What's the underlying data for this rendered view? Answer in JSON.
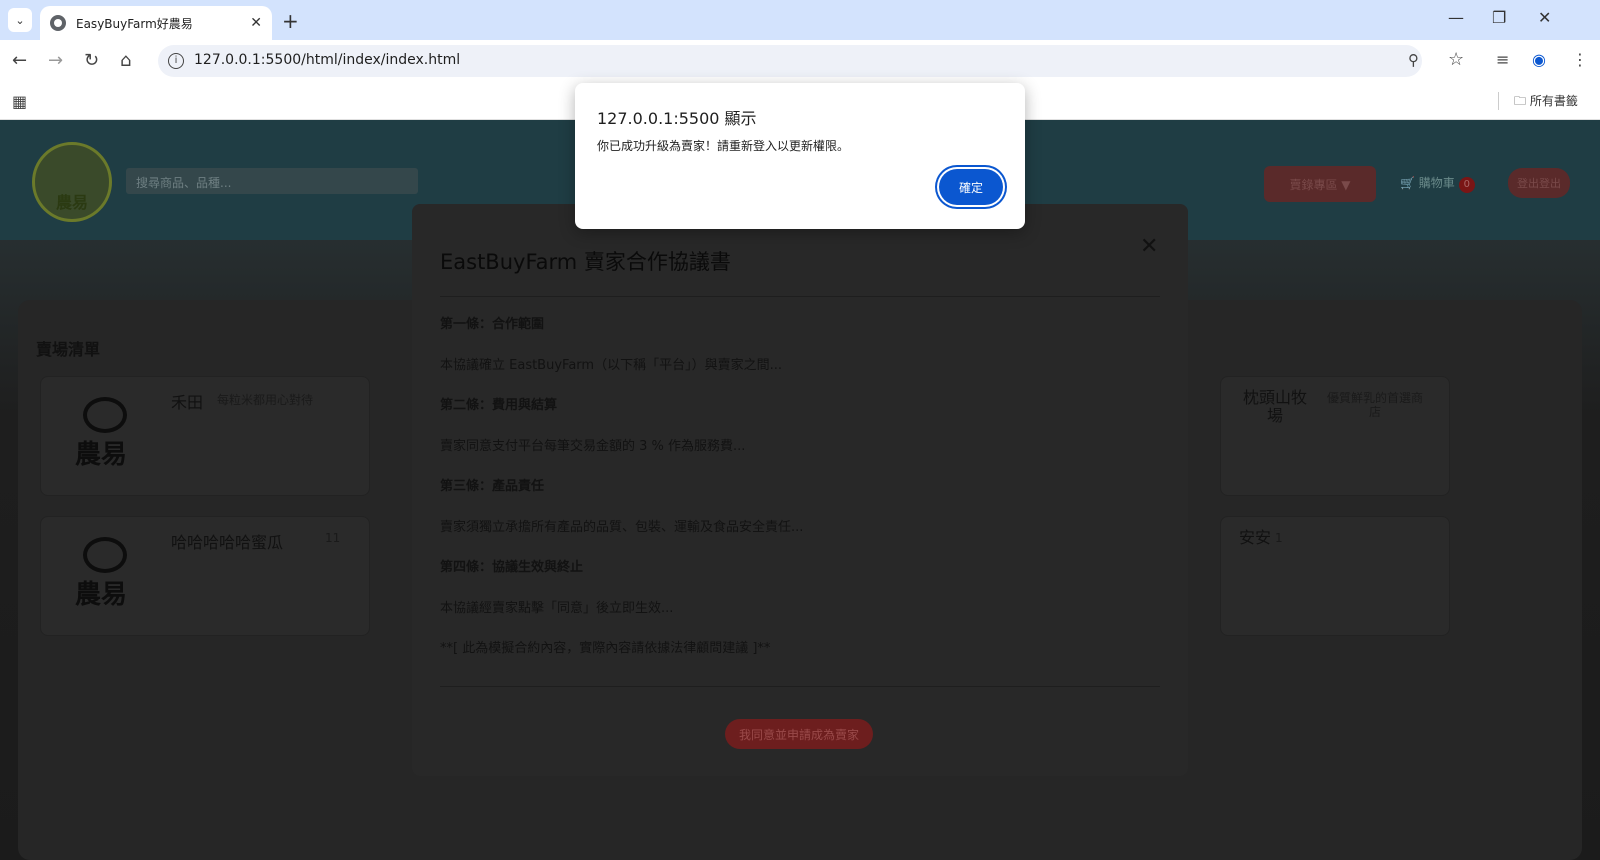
{
  "browser": {
    "tab_title": "EasyBuyFarm好農易",
    "tab_close": "✕",
    "new_tab": "+",
    "url": "127.0.0.1:5500/html/index/index.html",
    "bookmarks_folder": "所有書籤",
    "window_controls": [
      "—",
      "❐",
      "✕"
    ]
  },
  "page": {
    "logo_text": "農易",
    "search_placeholder": "搜尋商品、品種...",
    "seller_center": "賣錄專區 ▼",
    "cart_label": "購物車",
    "cart_count": "0",
    "logout": "登出登出"
  },
  "market": {
    "title": "賣場清單",
    "cards": [
      {
        "logo": "農易",
        "name": "禾田",
        "desc": "每粒米都用心對待"
      },
      {
        "logo": "農易",
        "name": "哈哈哈哈哈蜜瓜",
        "desc": "11"
      }
    ],
    "right_cards": [
      {
        "name": "枕頭山牧場",
        "desc": "優質鮮乳的首選商店"
      },
      {
        "name": "安安",
        "desc": "1"
      }
    ]
  },
  "modal": {
    "title": "EastBuyFarm 賣家合作協議書",
    "close": "✕",
    "paragraphs": [
      "第一條：合作範圍",
      "本協議確立 EastBuyFarm（以下稱「平台」）與賣家之間...",
      "第二條：費用與結算",
      "賣家同意支付平台每筆交易金額的 3 % 作為服務費...",
      "第三條：產品責任",
      "賣家須獨立承擔所有產品的品質、包裝、運輸及食品安全責任...",
      "第四條：協議生效與終止",
      "本協議經賣家點擊「同意」後立即生效...",
      "**[ 此為模擬合約內容，實際內容請依據法律顧問建議 ]**"
    ],
    "agree_button": "我同意並申請成為賣家"
  },
  "alert": {
    "origin": "127.0.0.1:5500 顯示",
    "message": "你已成功升級為賣家！請重新登入以更新權限。",
    "ok": "確定"
  }
}
